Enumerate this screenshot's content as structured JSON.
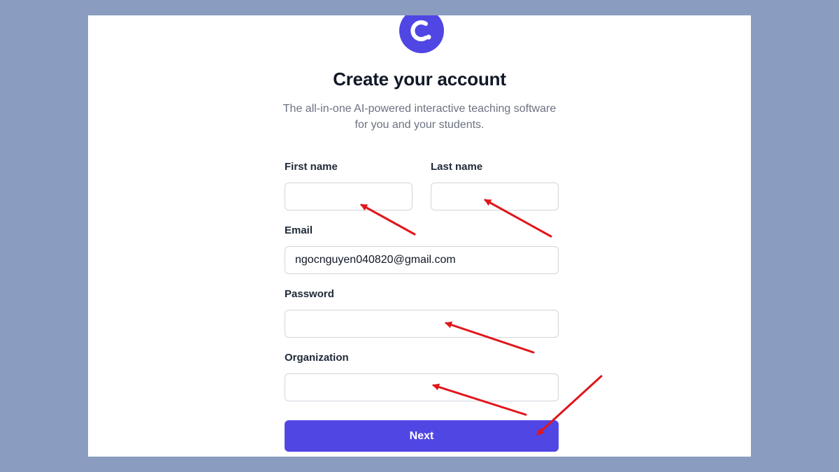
{
  "brand": {
    "logo_icon": "c-logo-icon",
    "accent_color": "#5046e4"
  },
  "page": {
    "title": "Create your account",
    "subtitle": "The all-in-one AI-powered interactive teaching software for you and your students."
  },
  "form": {
    "first_name": {
      "label": "First name",
      "value": ""
    },
    "last_name": {
      "label": "Last name",
      "value": ""
    },
    "email": {
      "label": "Email",
      "value": "ngocnguyen040820@gmail.com"
    },
    "password": {
      "label": "Password",
      "value": ""
    },
    "organization": {
      "label": "Organization",
      "value": ""
    },
    "next_label": "Next"
  },
  "annotations": {
    "arrow_color": "#e0161b",
    "arrow_icon": "red-arrow-icon"
  }
}
